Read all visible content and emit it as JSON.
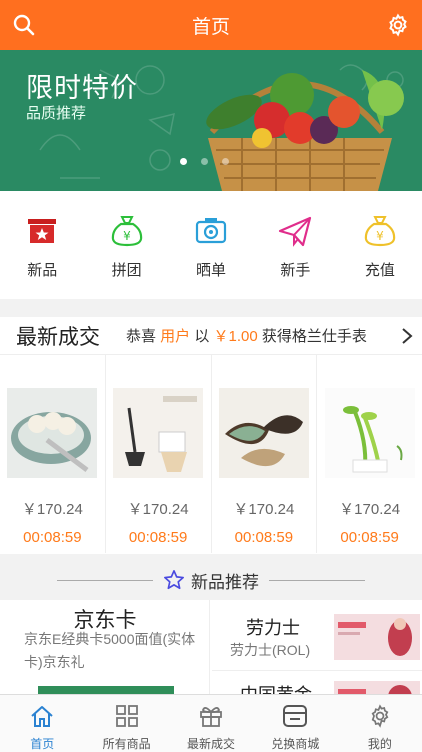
{
  "header": {
    "title": "首页"
  },
  "banner": {
    "title": "限时特价",
    "subtitle": "品质推荐",
    "slides": 3,
    "active_slide": 1
  },
  "quick": [
    {
      "label": "新品",
      "icon": "new-box-icon"
    },
    {
      "label": "拼团",
      "icon": "money-bag-icon"
    },
    {
      "label": "晒单",
      "icon": "camera-icon"
    },
    {
      "label": "新手",
      "icon": "paper-plane-icon"
    },
    {
      "label": "充值",
      "icon": "coin-bag-icon"
    }
  ],
  "deals": {
    "title": "最新成交",
    "ticker": {
      "pre": "恭喜 ",
      "user": "用户",
      "mid": " 以 ",
      "amount": "￥1.00",
      "post": " 获得格兰仕手表"
    },
    "products": [
      {
        "price": "￥170.24",
        "time": "00:08:59"
      },
      {
        "price": "￥170.24",
        "time": "00:08:59"
      },
      {
        "price": "￥170.24",
        "time": "00:08:59"
      },
      {
        "price": "￥170.24",
        "time": "00:08:59"
      }
    ]
  },
  "recommend": {
    "title": "新品推荐",
    "left": {
      "title": "京东卡",
      "desc": "京东E经典卡5000面值(实体卡)京东礼"
    },
    "right1": {
      "title": "劳力士",
      "desc": "劳力士(ROL)"
    },
    "right2": {
      "title": "中国黄金"
    }
  },
  "tabs": [
    {
      "label": "首页",
      "icon": "home-icon",
      "active": true
    },
    {
      "label": "所有商品",
      "icon": "grid-icon",
      "active": false
    },
    {
      "label": "最新成交",
      "icon": "gift-icon",
      "active": false
    },
    {
      "label": "兑换商城",
      "icon": "store-icon",
      "active": false
    },
    {
      "label": "我的",
      "icon": "settings-icon",
      "active": false
    }
  ],
  "colors": {
    "primary": "#ff6f1f",
    "accent": "#ff7a1a",
    "banner": "#2a8a63",
    "tab_active": "#2b82d1"
  }
}
